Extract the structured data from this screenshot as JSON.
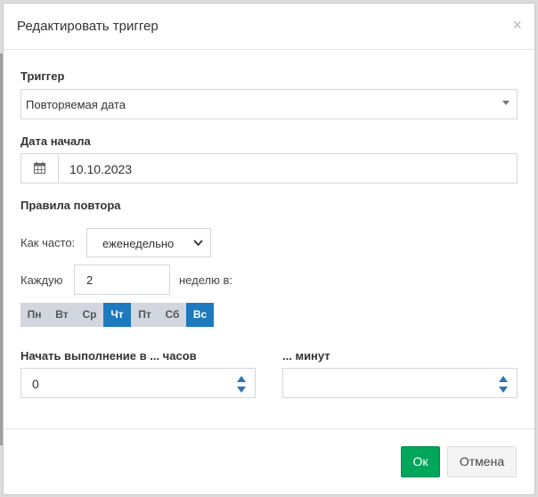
{
  "dialog": {
    "title": "Редактировать триггер",
    "close_glyph": "×"
  },
  "trigger": {
    "label": "Триггер",
    "value": "Повторяемая дата"
  },
  "start_date": {
    "label": "Дата начала",
    "value": "10.10.2023"
  },
  "repeat": {
    "label": "Правила повтора",
    "how_often_label": "Как часто:",
    "how_often_value": "еженедельно",
    "every_label": "Каждую",
    "every_value": "2",
    "week_suffix": "неделю в:",
    "days": [
      {
        "label": "Пн",
        "active": false
      },
      {
        "label": "Вт",
        "active": false
      },
      {
        "label": "Ср",
        "active": false
      },
      {
        "label": "Чт",
        "active": true
      },
      {
        "label": "Пт",
        "active": false
      },
      {
        "label": "Сб",
        "active": false
      },
      {
        "label": "Вс",
        "active": true
      }
    ]
  },
  "hours": {
    "label": "Начать выполнение в ... часов",
    "value": "0"
  },
  "minutes": {
    "label": "... минут",
    "value": ""
  },
  "buttons": {
    "ok": "Ок",
    "cancel": "Отмена"
  },
  "colors": {
    "accent": "#1e7abf",
    "ok": "#00a65a"
  }
}
